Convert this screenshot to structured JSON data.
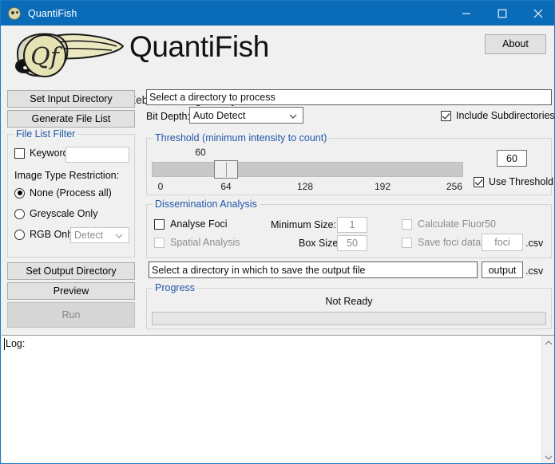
{
  "window": {
    "title": "QuantiFish",
    "icon": "fish-app-icon",
    "controls": {
      "minimize": "minimize-icon",
      "maximize": "maximize-icon",
      "close": "close-icon"
    },
    "accent_color": "#0a6cb8",
    "border_color": "#1a79c4"
  },
  "header": {
    "logo": "zebrafish-qf-logo",
    "app_name": "QuantiFish",
    "subtitle": "Zebrafish Image Analyser",
    "about_label": "About"
  },
  "sidebar": {
    "set_input_directory": "Set Input Directory",
    "generate_file_list": "Generate File List",
    "file_list_filter": {
      "title": "File List Filter",
      "keyword_label": "Keyword:",
      "keyword_checked": false,
      "keyword_value": "",
      "restriction_label": "Image Type Restriction:",
      "options": [
        {
          "label": "None (Process all)",
          "selected": true
        },
        {
          "label": "Greyscale Only",
          "selected": false
        },
        {
          "label": "RGB Only:",
          "selected": false
        }
      ],
      "rgb_channel_value": "Detect",
      "rgb_channel_enabled": false
    },
    "set_output_directory": "Set Output Directory",
    "preview": "Preview",
    "run": "Run",
    "run_enabled": false
  },
  "main": {
    "input_path_placeholder": "Select a directory to process",
    "bit_depth_label": "Bit Depth:",
    "bit_depth_value": "Auto Detect",
    "include_subdirectories_label": "Include Subdirectories",
    "include_subdirectories_checked": true,
    "threshold": {
      "title": "Threshold (minimum intensity to count)",
      "value": 60,
      "value_box": "60",
      "min": 0,
      "max": 256,
      "ticks": [
        "0",
        "64",
        "128",
        "192",
        "256"
      ],
      "use_threshold_label": "Use Threshold",
      "use_threshold_checked": true
    },
    "dissemination": {
      "title": "Dissemination Analysis",
      "analyse_foci_label": "Analyse Foci",
      "analyse_foci_checked": false,
      "spatial_analysis_label": "Spatial Analysis",
      "spatial_analysis_checked": false,
      "spatial_analysis_enabled": false,
      "minimum_size_label": "Minimum Size:",
      "minimum_size_value": "1",
      "box_size_label": "Box Size:",
      "box_size_value": "50",
      "calculate_fluor50_label": "Calculate Fluor50",
      "calculate_fluor50_checked": false,
      "save_foci_label": "Save foci data:",
      "save_foci_checked": false,
      "foci_filename": "foci",
      "foci_extension": ".csv"
    },
    "output_path_placeholder": "Select a directory in which to save the output file",
    "output_filename": "output",
    "output_extension": ".csv",
    "progress": {
      "title": "Progress",
      "status": "Not Ready",
      "percent": 0
    }
  },
  "log": {
    "label": "Log:",
    "scroll_up_icon": "chevron-up-icon",
    "scroll_down_icon": "chevron-down-icon"
  }
}
